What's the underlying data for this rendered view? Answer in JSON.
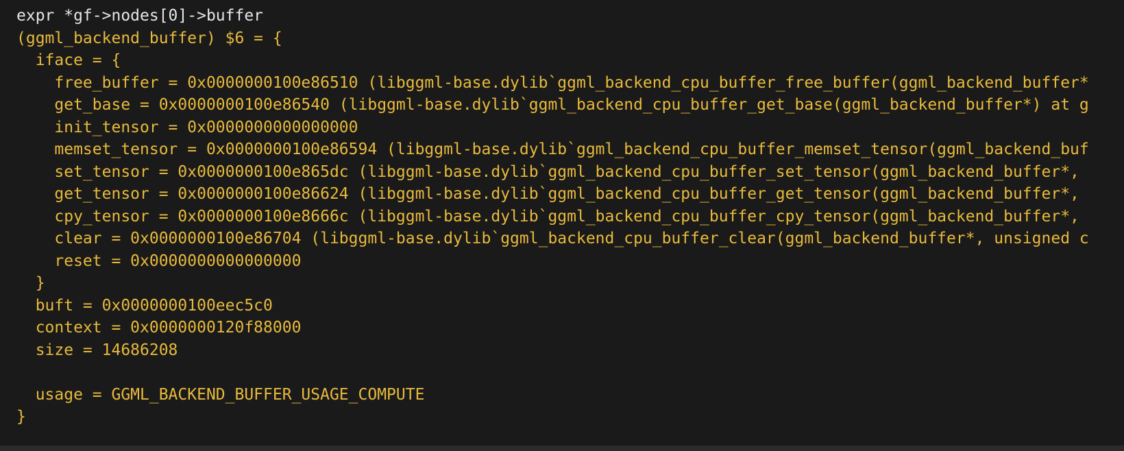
{
  "terminal": {
    "colors": {
      "background": "#1a1a1a",
      "command_text": "#e6e6e6",
      "output_text": "#e8ba3c"
    },
    "command": "expr *gf->nodes[0]->buffer",
    "output": [
      "(ggml_backend_buffer) $6 = {",
      "  iface = {",
      "    free_buffer = 0x0000000100e86510 (libggml-base.dylib`ggml_backend_cpu_buffer_free_buffer(ggml_backend_buffer*",
      "    get_base = 0x0000000100e86540 (libggml-base.dylib`ggml_backend_cpu_buffer_get_base(ggml_backend_buffer*) at g",
      "    init_tensor = 0x0000000000000000",
      "    memset_tensor = 0x0000000100e86594 (libggml-base.dylib`ggml_backend_cpu_buffer_memset_tensor(ggml_backend_buf",
      "    set_tensor = 0x0000000100e865dc (libggml-base.dylib`ggml_backend_cpu_buffer_set_tensor(ggml_backend_buffer*,",
      "    get_tensor = 0x0000000100e86624 (libggml-base.dylib`ggml_backend_cpu_buffer_get_tensor(ggml_backend_buffer*,",
      "    cpy_tensor = 0x0000000100e8666c (libggml-base.dylib`ggml_backend_cpu_buffer_cpy_tensor(ggml_backend_buffer*,",
      "    clear = 0x0000000100e86704 (libggml-base.dylib`ggml_backend_cpu_buffer_clear(ggml_backend_buffer*, unsigned c",
      "    reset = 0x0000000000000000",
      "  }",
      "  buft = 0x0000000100eec5c0",
      "  context = 0x0000000120f88000",
      "  size = 14686208",
      "",
      "  usage = GGML_BACKEND_BUFFER_USAGE_COMPUTE",
      "}"
    ]
  }
}
